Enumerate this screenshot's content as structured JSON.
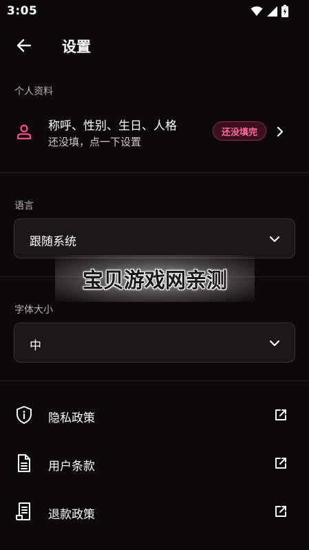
{
  "status_bar": {
    "time": "3:05",
    "icons": [
      "wifi-icon",
      "signal-icon",
      "battery-charging-icon"
    ]
  },
  "header": {
    "back_icon": "arrow-left-icon",
    "title": "设置"
  },
  "profile_section": {
    "label": "个人资料",
    "icon": "person-icon",
    "line1": "称呼、性别、生日、人格",
    "line2": "还没填，点一下设置",
    "badge": "还没填完",
    "chevron": "chevron-right-icon"
  },
  "language_section": {
    "label": "语言",
    "selected": "跟随系统"
  },
  "font_section": {
    "label": "字体大小",
    "selected": "中"
  },
  "links": [
    {
      "label": "隐私政策",
      "icon": "shield-info-icon"
    },
    {
      "label": "用户条款",
      "icon": "document-icon"
    },
    {
      "label": "退款政策",
      "icon": "receipt-icon"
    }
  ],
  "watermark": {
    "text": "宝贝游戏网亲测"
  },
  "colors": {
    "background": "#0d080c",
    "accent": "#ff4f86",
    "badge_bg": "#3a0f1f",
    "divider": "#241d22",
    "select_bg": "#1c1619"
  }
}
